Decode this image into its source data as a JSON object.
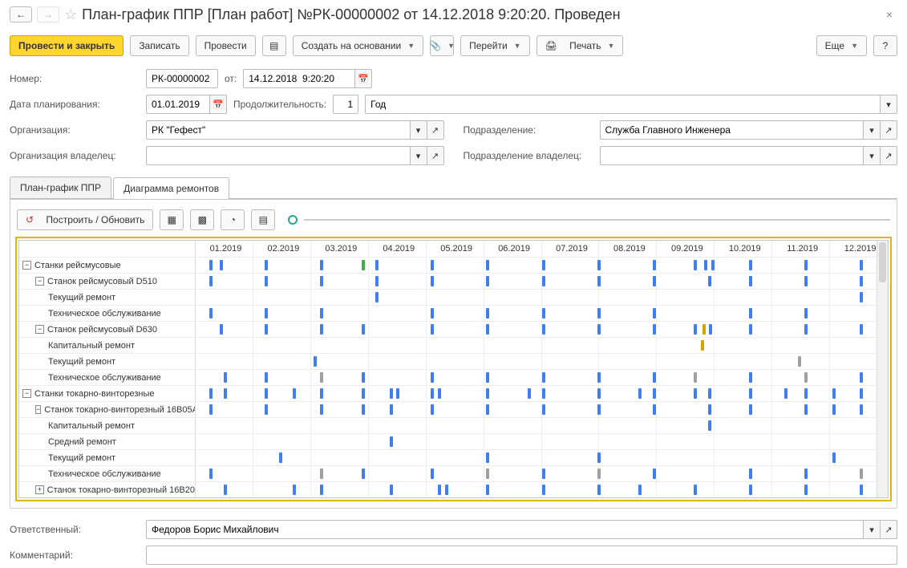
{
  "header": {
    "title": "План-график ППР [План работ] №РК-00000002 от 14.12.2018 9:20:20. Проведен"
  },
  "toolbar": {
    "post_and_close": "Провести и закрыть",
    "save": "Записать",
    "post": "Провести",
    "create_based": "Создать на основании",
    "goto": "Перейти",
    "print": "Печать",
    "more": "Еще"
  },
  "form": {
    "number_label": "Номер:",
    "number_value": "РК-00000002",
    "from_label": "от:",
    "date_value": "14.12.2018  9:20:20",
    "plan_date_label": "Дата планирования:",
    "plan_date_value": "01.01.2019",
    "duration_label": "Продолжительность:",
    "duration_value": "1",
    "duration_unit": "Год",
    "organization_label": "Организация:",
    "organization_value": "РК \"Гефест\"",
    "subdivision_label": "Подразделение:",
    "subdivision_value": "Служба Главного Инженера",
    "owner_org_label": "Организация владелец:",
    "owner_org_value": "",
    "owner_sub_label": "Подразделение владелец:",
    "owner_sub_value": "",
    "responsible_label": "Ответственный:",
    "responsible_value": "Федоров Борис Михайлович",
    "comment_label": "Комментарий:",
    "comment_value": ""
  },
  "tabs": {
    "tab1": "План-график ППР",
    "tab2": "Диаграмма ремонтов"
  },
  "gantt_toolbar": {
    "build": "Построить / Обновить"
  },
  "months": [
    "01.2019",
    "02.2019",
    "03.2019",
    "04.2019",
    "05.2019",
    "06.2019",
    "07.2019",
    "08.2019",
    "09.2019",
    "10.2019",
    "11.2019",
    "12.2019"
  ],
  "rows": [
    {
      "indent": 0,
      "toggle": "−",
      "label": "Станки рейсмусовые",
      "marks": [
        {
          "p": 2,
          "c": "blue"
        },
        {
          "p": 3.5,
          "c": "blue"
        },
        {
          "p": 10,
          "c": "blue"
        },
        {
          "p": 18,
          "c": "blue"
        },
        {
          "p": 24,
          "c": "green"
        },
        {
          "p": 26,
          "c": "blue"
        },
        {
          "p": 34,
          "c": "blue"
        },
        {
          "p": 42,
          "c": "blue"
        },
        {
          "p": 50,
          "c": "blue"
        },
        {
          "p": 58,
          "c": "blue"
        },
        {
          "p": 66,
          "c": "blue"
        },
        {
          "p": 72,
          "c": "blue"
        },
        {
          "p": 73.5,
          "c": "blue"
        },
        {
          "p": 74.5,
          "c": "blue"
        },
        {
          "p": 80,
          "c": "blue"
        },
        {
          "p": 88,
          "c": "blue"
        },
        {
          "p": 96,
          "c": "blue"
        }
      ]
    },
    {
      "indent": 1,
      "toggle": "−",
      "label": "Станок рейсмусовый D510",
      "marks": [
        {
          "p": 2,
          "c": "blue"
        },
        {
          "p": 10,
          "c": "blue"
        },
        {
          "p": 18,
          "c": "blue"
        },
        {
          "p": 26,
          "c": "blue"
        },
        {
          "p": 34,
          "c": "blue"
        },
        {
          "p": 42,
          "c": "blue"
        },
        {
          "p": 50,
          "c": "blue"
        },
        {
          "p": 58,
          "c": "blue"
        },
        {
          "p": 66,
          "c": "blue"
        },
        {
          "p": 74,
          "c": "blue"
        },
        {
          "p": 80,
          "c": "blue"
        },
        {
          "p": 88,
          "c": "blue"
        },
        {
          "p": 96,
          "c": "blue"
        }
      ]
    },
    {
      "indent": 2,
      "toggle": "",
      "label": "Текущий ремонт",
      "marks": [
        {
          "p": 26,
          "c": "blue"
        },
        {
          "p": 96,
          "c": "blue"
        }
      ]
    },
    {
      "indent": 2,
      "toggle": "",
      "label": "Техническое обслуживание",
      "marks": [
        {
          "p": 2,
          "c": "blue"
        },
        {
          "p": 10,
          "c": "blue"
        },
        {
          "p": 18,
          "c": "blue"
        },
        {
          "p": 34,
          "c": "blue"
        },
        {
          "p": 42,
          "c": "blue"
        },
        {
          "p": 50,
          "c": "blue"
        },
        {
          "p": 58,
          "c": "blue"
        },
        {
          "p": 66,
          "c": "blue"
        },
        {
          "p": 80,
          "c": "blue"
        },
        {
          "p": 88,
          "c": "blue"
        }
      ]
    },
    {
      "indent": 1,
      "toggle": "−",
      "label": "Станок рейсмусовый D630",
      "marks": [
        {
          "p": 3.5,
          "c": "blue"
        },
        {
          "p": 10,
          "c": "blue"
        },
        {
          "p": 18,
          "c": "blue"
        },
        {
          "p": 24,
          "c": "blue"
        },
        {
          "p": 34,
          "c": "blue"
        },
        {
          "p": 42,
          "c": "blue"
        },
        {
          "p": 50,
          "c": "blue"
        },
        {
          "p": 58,
          "c": "blue"
        },
        {
          "p": 66,
          "c": "blue"
        },
        {
          "p": 72,
          "c": "blue"
        },
        {
          "p": 73.2,
          "c": "gold"
        },
        {
          "p": 74.2,
          "c": "blue"
        },
        {
          "p": 80,
          "c": "blue"
        },
        {
          "p": 88,
          "c": "blue"
        },
        {
          "p": 96,
          "c": "blue"
        }
      ]
    },
    {
      "indent": 2,
      "toggle": "",
      "label": "Капитальный ремонт",
      "marks": [
        {
          "p": 73,
          "c": "gold"
        }
      ]
    },
    {
      "indent": 2,
      "toggle": "",
      "label": "Текущий ремонт",
      "marks": [
        {
          "p": 17,
          "c": "blue"
        },
        {
          "p": 87,
          "c": "grey"
        }
      ]
    },
    {
      "indent": 2,
      "toggle": "",
      "label": "Техническое обслуживание",
      "marks": [
        {
          "p": 4,
          "c": "blue"
        },
        {
          "p": 10,
          "c": "blue"
        },
        {
          "p": 18,
          "c": "grey"
        },
        {
          "p": 24,
          "c": "blue"
        },
        {
          "p": 34,
          "c": "blue"
        },
        {
          "p": 42,
          "c": "blue"
        },
        {
          "p": 50,
          "c": "blue"
        },
        {
          "p": 58,
          "c": "blue"
        },
        {
          "p": 66,
          "c": "blue"
        },
        {
          "p": 72,
          "c": "grey"
        },
        {
          "p": 80,
          "c": "blue"
        },
        {
          "p": 88,
          "c": "grey"
        },
        {
          "p": 96,
          "c": "blue"
        }
      ]
    },
    {
      "indent": 0,
      "toggle": "−",
      "label": "Станки токарно-винторезные",
      "marks": [
        {
          "p": 2,
          "c": "blue"
        },
        {
          "p": 4,
          "c": "blue"
        },
        {
          "p": 10,
          "c": "blue"
        },
        {
          "p": 14,
          "c": "blue"
        },
        {
          "p": 18,
          "c": "blue"
        },
        {
          "p": 24,
          "c": "blue"
        },
        {
          "p": 28,
          "c": "blue"
        },
        {
          "p": 29,
          "c": "blue"
        },
        {
          "p": 34,
          "c": "blue"
        },
        {
          "p": 35,
          "c": "blue"
        },
        {
          "p": 42,
          "c": "blue"
        },
        {
          "p": 48,
          "c": "blue"
        },
        {
          "p": 50,
          "c": "blue"
        },
        {
          "p": 58,
          "c": "blue"
        },
        {
          "p": 64,
          "c": "blue"
        },
        {
          "p": 66,
          "c": "blue"
        },
        {
          "p": 72,
          "c": "blue"
        },
        {
          "p": 74,
          "c": "blue"
        },
        {
          "p": 80,
          "c": "blue"
        },
        {
          "p": 85,
          "c": "blue"
        },
        {
          "p": 88,
          "c": "blue"
        },
        {
          "p": 92,
          "c": "blue"
        },
        {
          "p": 96,
          "c": "blue"
        }
      ]
    },
    {
      "indent": 1,
      "toggle": "−",
      "label": "Станок токарно-винторезный 16В05А",
      "marks": [
        {
          "p": 2,
          "c": "blue"
        },
        {
          "p": 10,
          "c": "blue"
        },
        {
          "p": 18,
          "c": "blue"
        },
        {
          "p": 24,
          "c": "blue"
        },
        {
          "p": 28,
          "c": "blue"
        },
        {
          "p": 34,
          "c": "blue"
        },
        {
          "p": 42,
          "c": "blue"
        },
        {
          "p": 50,
          "c": "blue"
        },
        {
          "p": 58,
          "c": "blue"
        },
        {
          "p": 66,
          "c": "blue"
        },
        {
          "p": 74,
          "c": "blue"
        },
        {
          "p": 80,
          "c": "blue"
        },
        {
          "p": 88,
          "c": "blue"
        },
        {
          "p": 92,
          "c": "blue"
        },
        {
          "p": 96,
          "c": "blue"
        }
      ]
    },
    {
      "indent": 2,
      "toggle": "",
      "label": "Капитальный ремонт",
      "marks": [
        {
          "p": 74,
          "c": "blue"
        }
      ]
    },
    {
      "indent": 2,
      "toggle": "",
      "label": "Средний ремонт",
      "marks": [
        {
          "p": 28,
          "c": "blue"
        }
      ]
    },
    {
      "indent": 2,
      "toggle": "",
      "label": "Текущий ремонт",
      "marks": [
        {
          "p": 12,
          "c": "blue"
        },
        {
          "p": 42,
          "c": "blue"
        },
        {
          "p": 58,
          "c": "blue"
        },
        {
          "p": 92,
          "c": "blue"
        }
      ]
    },
    {
      "indent": 2,
      "toggle": "",
      "label": "Техническое обслуживание",
      "marks": [
        {
          "p": 2,
          "c": "blue"
        },
        {
          "p": 18,
          "c": "grey"
        },
        {
          "p": 24,
          "c": "blue"
        },
        {
          "p": 34,
          "c": "blue"
        },
        {
          "p": 42,
          "c": "grey"
        },
        {
          "p": 50,
          "c": "blue"
        },
        {
          "p": 58,
          "c": "grey"
        },
        {
          "p": 66,
          "c": "blue"
        },
        {
          "p": 80,
          "c": "blue"
        },
        {
          "p": 88,
          "c": "blue"
        },
        {
          "p": 96,
          "c": "grey"
        }
      ]
    },
    {
      "indent": 1,
      "toggle": "+",
      "label": "Станок токарно-винторезный 16В20",
      "marks": [
        {
          "p": 4,
          "c": "blue"
        },
        {
          "p": 14,
          "c": "blue"
        },
        {
          "p": 18,
          "c": "blue"
        },
        {
          "p": 28,
          "c": "blue"
        },
        {
          "p": 35,
          "c": "blue"
        },
        {
          "p": 36,
          "c": "blue"
        },
        {
          "p": 42,
          "c": "blue"
        },
        {
          "p": 50,
          "c": "blue"
        },
        {
          "p": 58,
          "c": "blue"
        },
        {
          "p": 64,
          "c": "blue"
        },
        {
          "p": 72,
          "c": "blue"
        },
        {
          "p": 80,
          "c": "blue"
        },
        {
          "p": 88,
          "c": "blue"
        },
        {
          "p": 96,
          "c": "blue"
        }
      ]
    }
  ]
}
